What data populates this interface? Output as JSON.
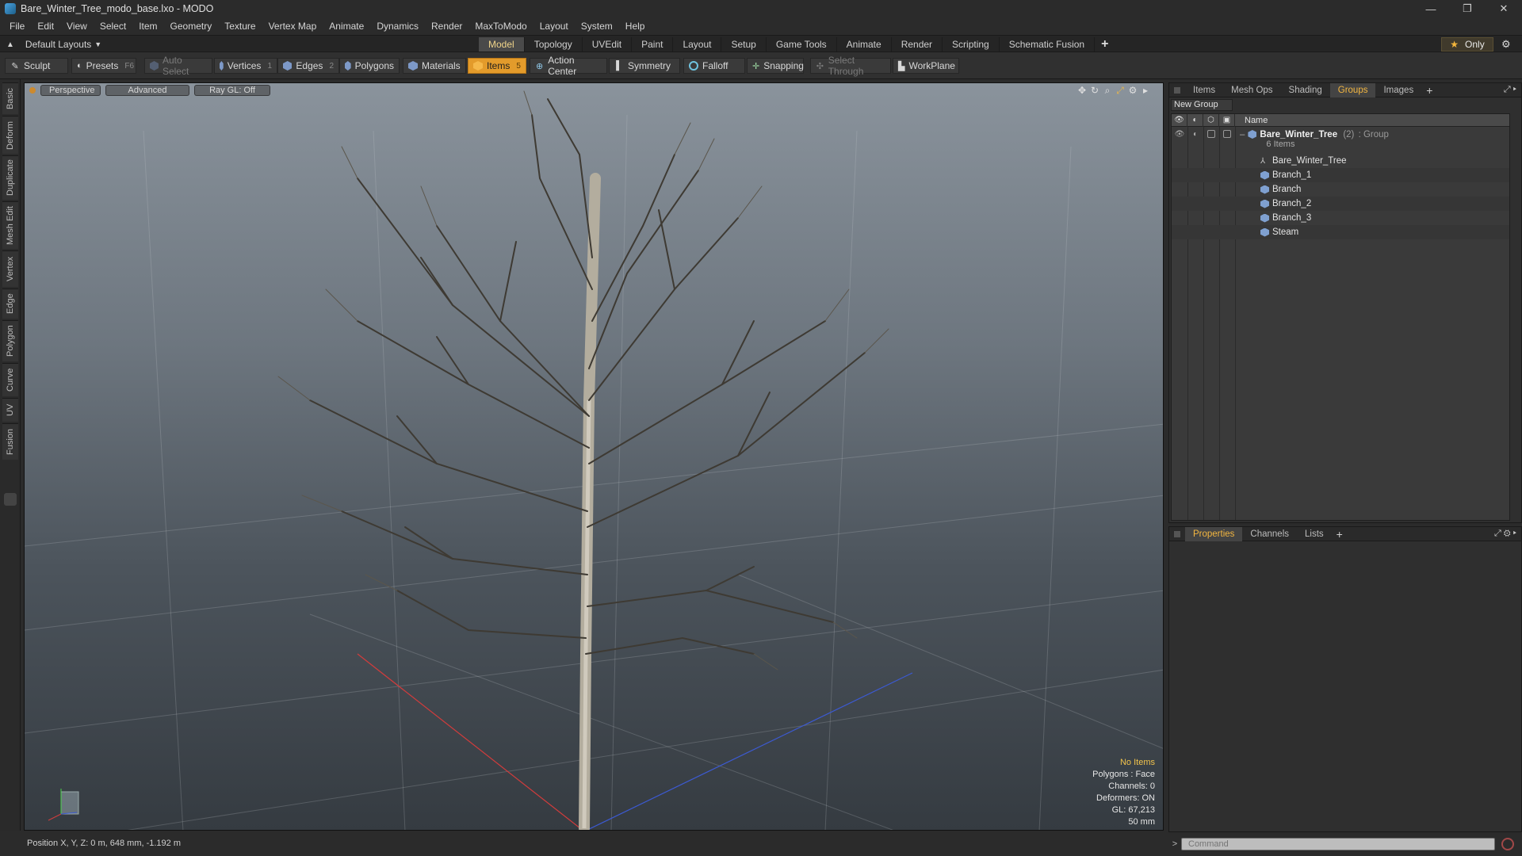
{
  "window": {
    "title": "Bare_Winter_Tree_modo_base.lxo - MODO",
    "minimize": "—",
    "restore": "❐",
    "close": "✕"
  },
  "menu": [
    "File",
    "Edit",
    "View",
    "Select",
    "Item",
    "Geometry",
    "Texture",
    "Vertex Map",
    "Animate",
    "Dynamics",
    "Render",
    "MaxToModo",
    "Layout",
    "System",
    "Help"
  ],
  "layout_bar": {
    "layouts_label": "Default Layouts",
    "tabs": [
      "Model",
      "Topology",
      "UVEdit",
      "Paint",
      "Layout",
      "Setup",
      "Game Tools",
      "Animate",
      "Render",
      "Scripting",
      "Schematic Fusion"
    ],
    "active_tab": "Model",
    "plus": "+",
    "only_label": "Only"
  },
  "toolbar": {
    "sculpt": "Sculpt",
    "presets": "Presets",
    "presets_key": "F6",
    "auto_select": "Auto Select",
    "vertices": "Vertices",
    "vertices_key": "1",
    "edges": "Edges",
    "edges_key": "2",
    "polygons": "Polygons",
    "materials": "Materials",
    "items": "Items",
    "items_key": "5",
    "action_center": "Action Center",
    "symmetry": "Symmetry",
    "falloff": "Falloff",
    "snapping": "Snapping",
    "select_through": "Select Through",
    "workplane": "WorkPlane"
  },
  "left_tabs": [
    "Basic",
    "Deform",
    "Duplicate",
    "Mesh Edit",
    "Vertex",
    "Edge",
    "Polygon",
    "Curve",
    "UV",
    "Fusion"
  ],
  "viewport": {
    "view": "Perspective",
    "style": "Advanced",
    "raygl": "Ray GL: Off",
    "info": {
      "selection": "No Items",
      "polygons": "Polygons : Face",
      "channels": "Channels: 0",
      "deformers": "Deformers: ON",
      "gl": "GL: 67,213",
      "scale": "50 mm"
    }
  },
  "status": {
    "position": "Position X, Y, Z:  0 m, 648 mm, -1.192 m"
  },
  "right_top": {
    "tabs": [
      "Items",
      "Mesh Ops",
      "Shading",
      "Groups",
      "Images"
    ],
    "active_tab": "Groups",
    "plus": "+",
    "new_group": "New Group",
    "name_col": "Name",
    "group": {
      "name": "Bare_Winter_Tree",
      "count": "(2)",
      "type": ": Group",
      "sub": "6 Items"
    },
    "items": [
      "Bare_Winter_Tree",
      "Branch_1",
      "Branch",
      "Branch_2",
      "Branch_3",
      "Steam"
    ]
  },
  "right_bottom": {
    "tabs": [
      "Properties",
      "Channels",
      "Lists"
    ],
    "active_tab": "Properties",
    "plus": "+"
  },
  "command": {
    "placeholder": "Command"
  },
  "colors": {
    "accent": "#e39b2b",
    "active_text": "#f3b640",
    "x_axis": "#d23c3c",
    "z_axis": "#3c5ad2"
  }
}
